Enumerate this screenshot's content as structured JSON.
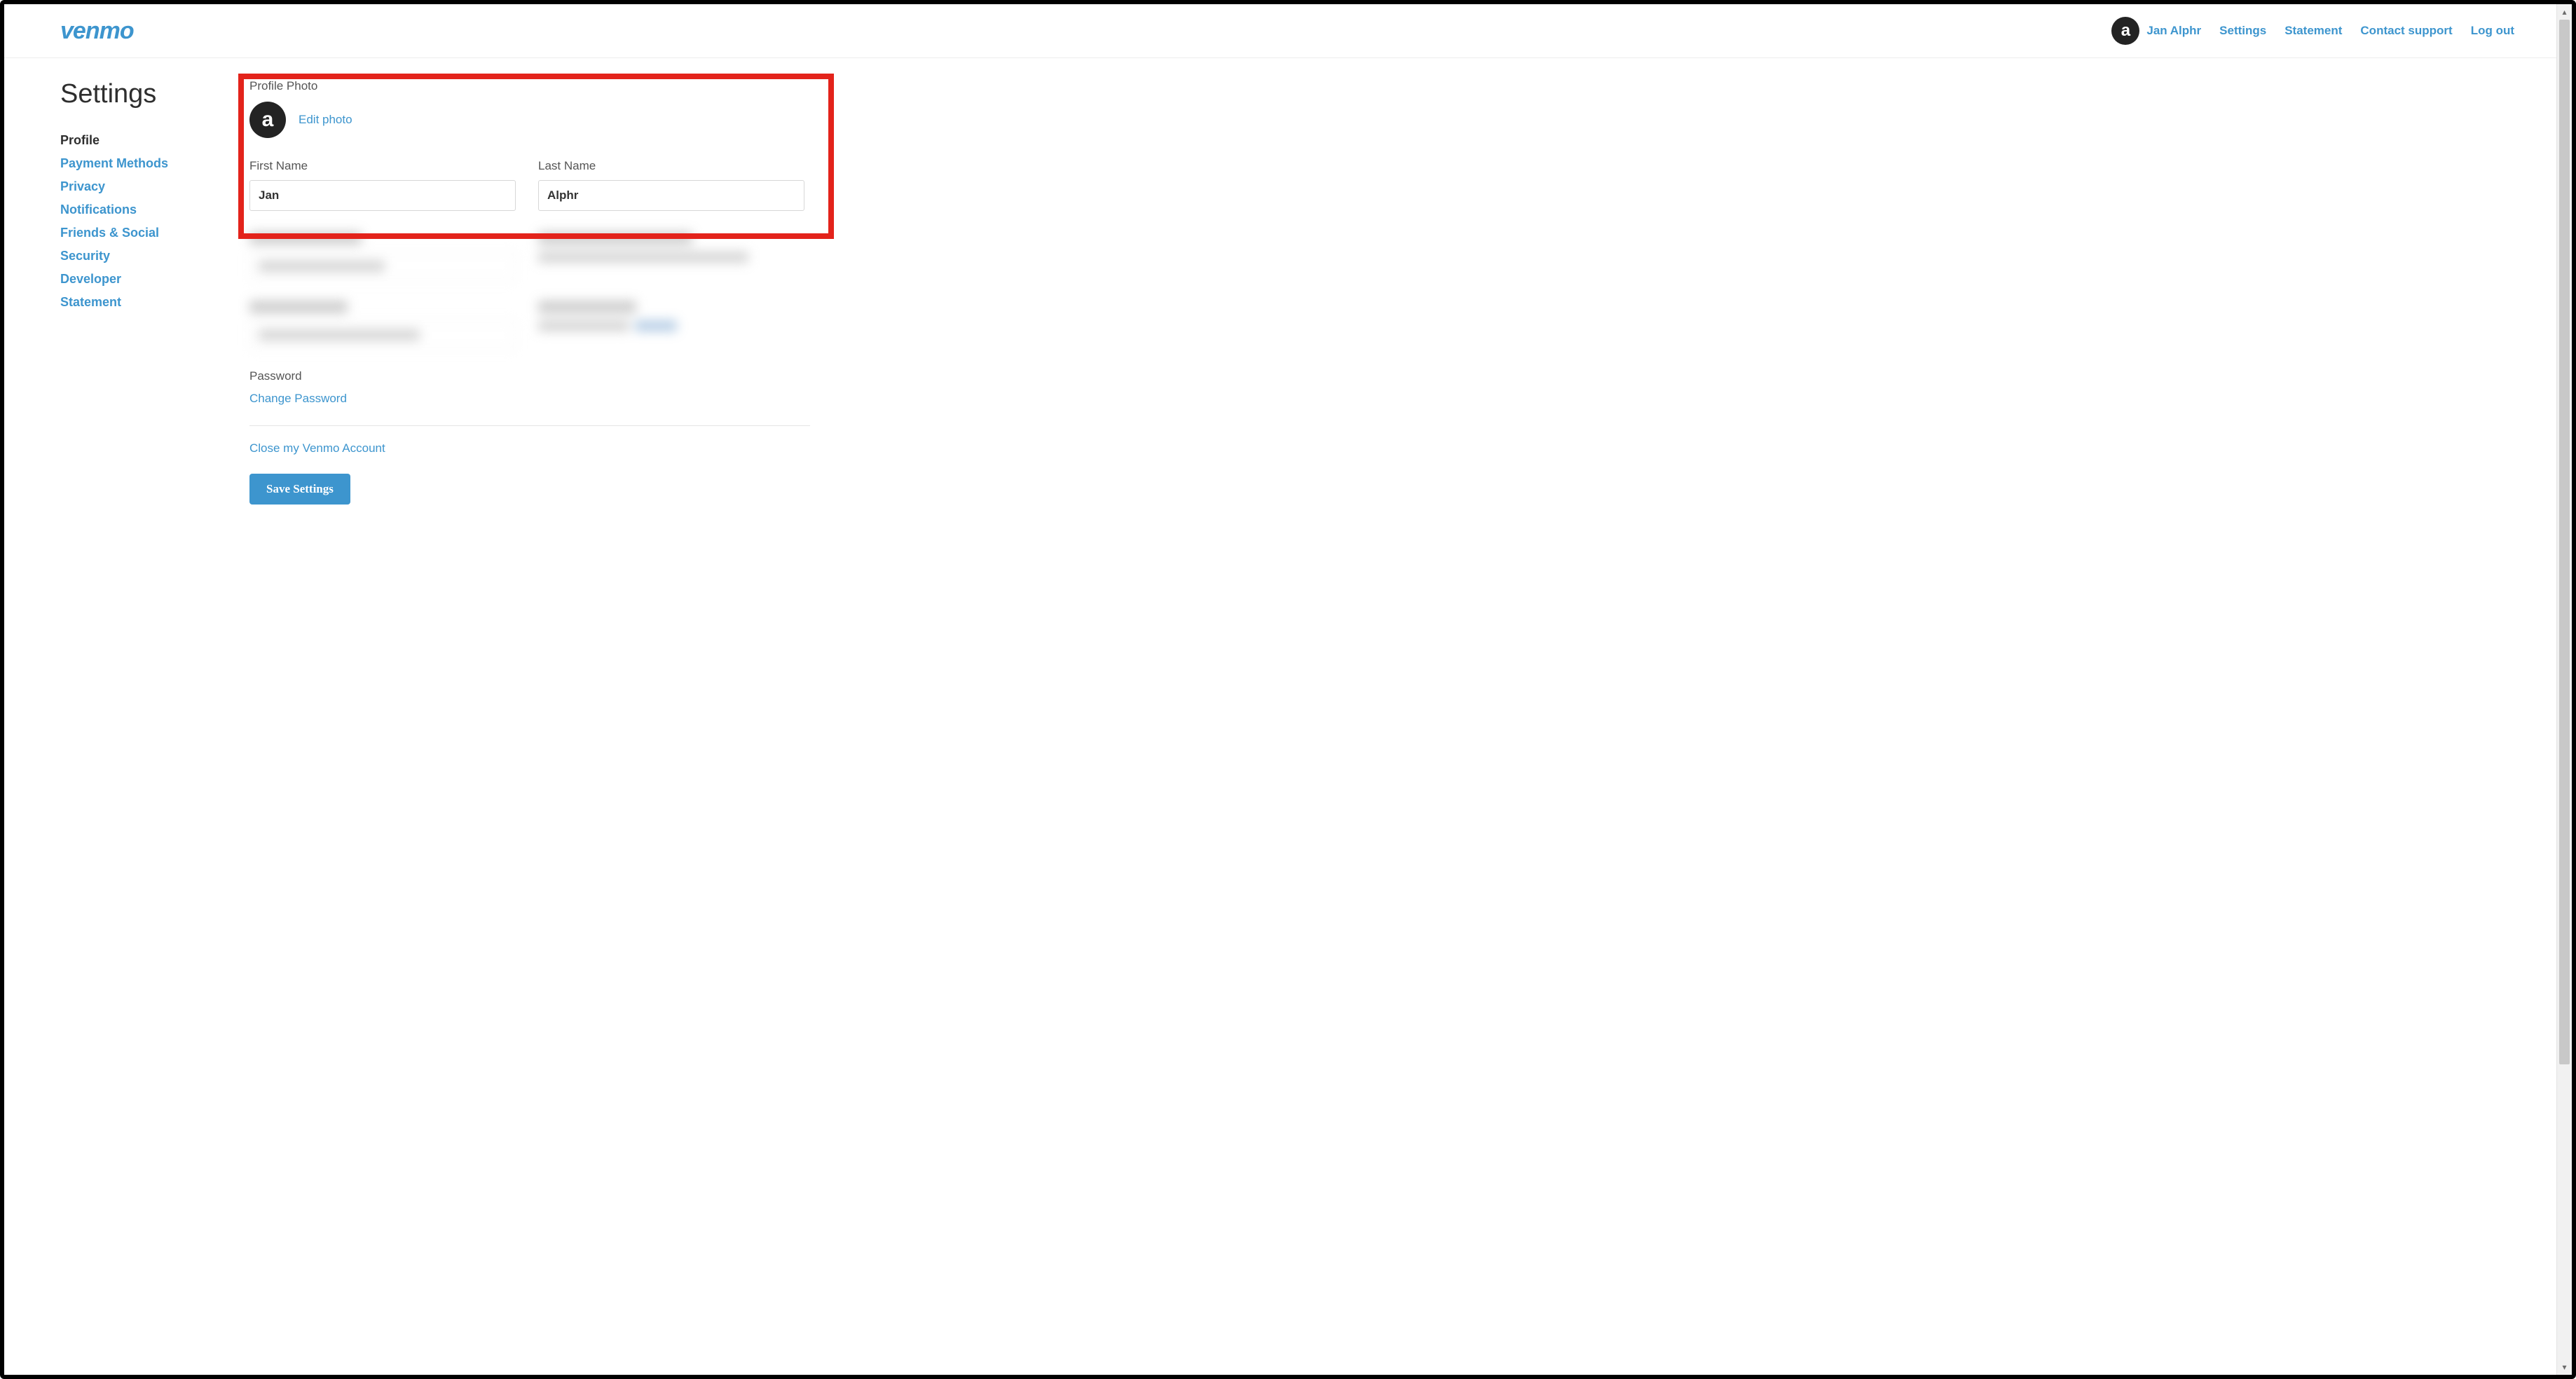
{
  "brand": {
    "logo": "venmo"
  },
  "topnav": {
    "user_name": "Jan Alphr",
    "avatar_letter": "a",
    "links": {
      "settings": "Settings",
      "statement": "Statement",
      "contact": "Contact support",
      "logout": "Log out"
    }
  },
  "page": {
    "title": "Settings"
  },
  "sidebar": {
    "items": [
      {
        "label": "Profile",
        "active": true
      },
      {
        "label": "Payment Methods"
      },
      {
        "label": "Privacy"
      },
      {
        "label": "Notifications"
      },
      {
        "label": "Friends & Social"
      },
      {
        "label": "Security"
      },
      {
        "label": "Developer"
      },
      {
        "label": "Statement"
      }
    ]
  },
  "profile": {
    "photo_section_label": "Profile Photo",
    "edit_photo": "Edit photo",
    "first_name_label": "First Name",
    "first_name_value": "Jan",
    "last_name_label": "Last Name",
    "last_name_value": "Alphr",
    "password_label": "Password",
    "change_password": "Change Password",
    "close_account": "Close my Venmo Account",
    "save_button": "Save Settings"
  }
}
